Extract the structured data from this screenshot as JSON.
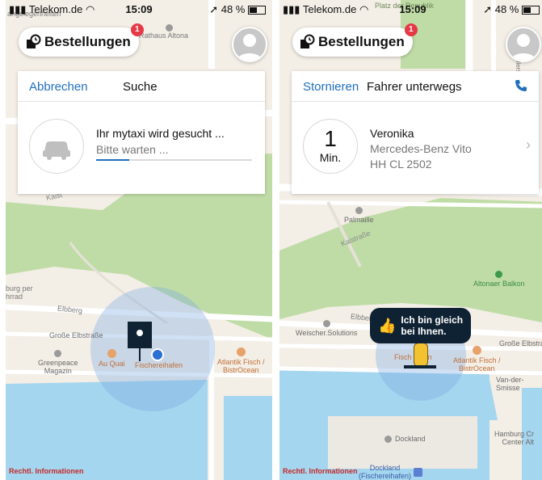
{
  "status_bar": {
    "left_carrier": "Telekom.de",
    "left_time": "15:09",
    "left_battery": "48 %",
    "right_carrier": "Telekom.de",
    "right_time": "15:09",
    "right_battery": "48 %"
  },
  "orders_button": {
    "label": "Bestellungen",
    "badge": "1"
  },
  "left_screen": {
    "cancel_label": "Abbrechen",
    "title": "Suche",
    "search_title": "Ihr mytaxi wird gesucht ...",
    "search_subtitle": "Bitte warten ...",
    "progress": 0.21,
    "map_labels": {
      "rathaus": "Rathaus Altona",
      "angelegenheiten": "angelegenheiten",
      "kaist": "Kaist",
      "elbberg": "Elbberg",
      "grosse_elbstrasse": "Große Elbstraße",
      "greenpeace": "Greenpeace\nMagazin",
      "au_quai": "Au Quai",
      "fischereihafen": "Fischereihafen",
      "atlantik": "Atlantik Fisch /\nBistrOcean",
      "burg_per": "burg per\nhrrad",
      "legal": "Rechtl. Informationen"
    }
  },
  "right_screen": {
    "cancel_label": "Stornieren",
    "title": "Fahrer unterwegs",
    "eta_number": "1",
    "eta_unit": "Min.",
    "driver_name": "Veronika",
    "vehicle": "Mercedes-Benz Vito",
    "plate": "HH CL 2502",
    "bubble_text": "Ich bin gleich\nbei Ihnen.",
    "map_labels": {
      "platz": "Platz der Republik",
      "palmaille": "Palmaille",
      "kaistrasse": "Kaistraße",
      "altonaer_balkon": "Altonaer Balkon",
      "weischer": "Weischer.Solutions",
      "elbberg": "Elbberg",
      "grosse_elbstrasse": "Große Elbstra",
      "atlantik": "Atlantik Fisch /\nBistrOcean",
      "van_der_smissen": "Van-der-Smisse",
      "dockland": "Dockland",
      "dockland_stop": "Dockland\n(Fischereihafen)",
      "hamburg_cruise": "Hamburg Cr\nCenter Alt",
      "legal": "Rechtl. Informationen",
      "schillerstrasse": "Schillerstraße",
      "fisch_hafen": "Fisch hafen"
    }
  },
  "colors": {
    "accent": "#1f6fbf",
    "badge": "#e63946",
    "water": "#a5d6ef",
    "park": "#bfdca6",
    "road": "#ffffff",
    "dark_marker": "#0f2233"
  }
}
